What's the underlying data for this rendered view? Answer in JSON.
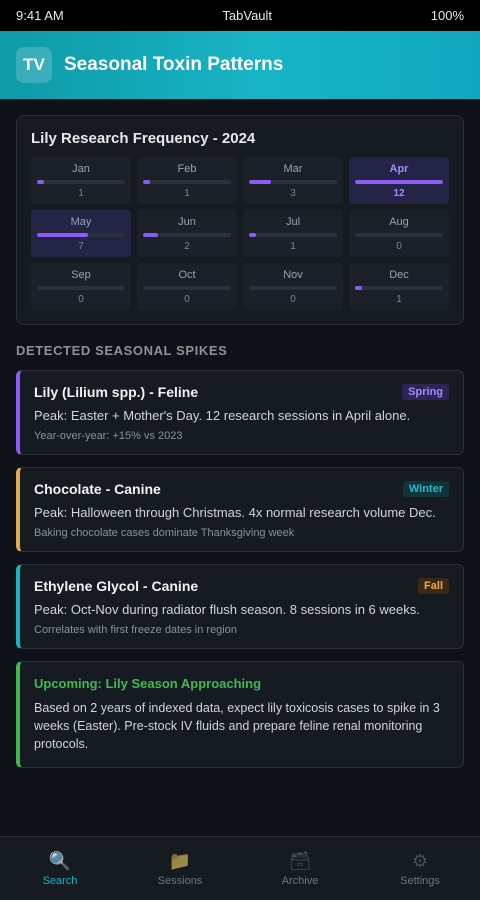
{
  "status_bar": {
    "time": "9:41 AM",
    "carrier": "TabVault",
    "battery": "100%"
  },
  "header": {
    "logo_text": "TV",
    "title": "Seasonal Toxin Patterns"
  },
  "calendar": {
    "title": "Lily Research Frequency - 2024",
    "max_value": 12,
    "months": [
      {
        "name": "Jan",
        "count": "1",
        "value": 1
      },
      {
        "name": "Feb",
        "count": "1",
        "value": 1
      },
      {
        "name": "Mar",
        "count": "3",
        "value": 3
      },
      {
        "name": "Apr",
        "count": "12",
        "value": 12
      },
      {
        "name": "May",
        "count": "7",
        "value": 7
      },
      {
        "name": "Jun",
        "count": "2",
        "value": 2
      },
      {
        "name": "Jul",
        "count": "1",
        "value": 1
      },
      {
        "name": "Aug",
        "count": "0",
        "value": 0
      },
      {
        "name": "Sep",
        "count": "0",
        "value": 0
      },
      {
        "name": "Oct",
        "count": "0",
        "value": 0
      },
      {
        "name": "Nov",
        "count": "0",
        "value": 0
      },
      {
        "name": "Dec",
        "count": "1",
        "value": 1
      }
    ]
  },
  "spikes_section": {
    "heading": "DETECTED SEASONAL SPIKES"
  },
  "spikes": [
    {
      "title": "Lily (Lilium spp.) - Feline",
      "season": "Spring",
      "accent_color": "#8b5cf6",
      "badge_bg": "#2e2458",
      "badge_color": "#a78bfa",
      "description": "Peak: Easter + Mother's Day. 12 research sessions in April alone.",
      "note": "Year-over-year: +15% vs 2023"
    },
    {
      "title": "Chocolate - Canine",
      "season": "Winter",
      "accent_color": "#e3a854",
      "badge_bg": "#10343a",
      "badge_color": "#22b8c8",
      "description": "Peak: Halloween through Christmas. 4x normal research volume Dec.",
      "note": "Baking chocolate cases dominate Thanksgiving week"
    },
    {
      "title": "Ethylene Glycol - Canine",
      "season": "Fall",
      "accent_color": "#18b4c6",
      "badge_bg": "#3a2a14",
      "badge_color": "#f0a948",
      "description": "Peak: Oct-Nov during radiator flush season. 8 sessions in 6 weeks.",
      "note": "Correlates with first freeze dates in region"
    }
  ],
  "upcoming": {
    "title": "Upcoming: Lily Season Approaching",
    "body": "Based on 2 years of indexed data, expect lily toxicosis cases to spike in 3 weeks (Easter). Pre-stock IV fluids and prepare feline renal monitoring protocols."
  },
  "tab_bar": {
    "tabs": [
      {
        "label": "Search",
        "icon": "search-icon",
        "active": true
      },
      {
        "label": "Sessions",
        "icon": "folder-icon",
        "active": false
      },
      {
        "label": "Archive",
        "icon": "archive-icon",
        "active": false
      },
      {
        "label": "Settings",
        "icon": "gear-icon",
        "active": false
      }
    ]
  }
}
